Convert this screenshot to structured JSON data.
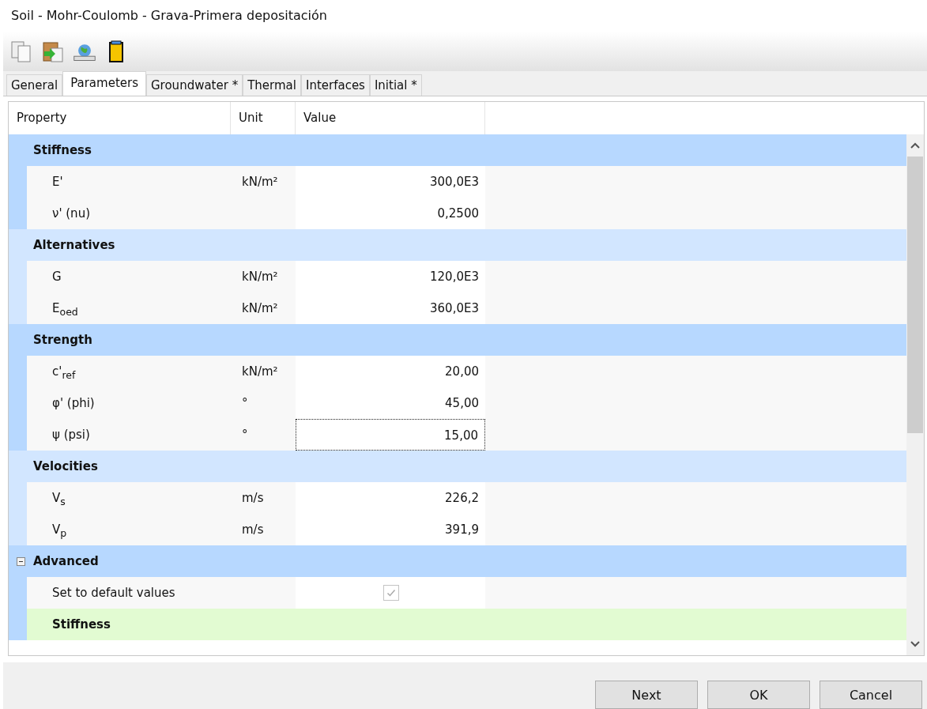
{
  "window": {
    "title": "Soil - Mohr-Coulomb - Grava-Primera depositación"
  },
  "toolbar": [
    {
      "kind": "copy"
    },
    {
      "kind": "paste"
    },
    {
      "kind": "globe"
    },
    {
      "kind": "column"
    }
  ],
  "tabs": [
    {
      "label": "General",
      "selected": false
    },
    {
      "label": "Parameters",
      "selected": true
    },
    {
      "label": "Groundwater *",
      "selected": false
    },
    {
      "label": "Thermal",
      "selected": false
    },
    {
      "label": "Interfaces",
      "selected": false
    },
    {
      "label": "Initial *",
      "selected": false
    }
  ],
  "table": {
    "columns": [
      "Property",
      "Unit",
      "Value"
    ],
    "groups": [
      {
        "title": "Stiffness",
        "color": "#b7d8ff",
        "rows": [
          {
            "kind": "param",
            "name": "E'",
            "unit": "kN/m²",
            "value": "300,0E3",
            "focused": false
          },
          {
            "kind": "param",
            "name": "ν' (nu)",
            "value": "0,2500",
            "focused": false
          }
        ]
      },
      {
        "title": "Alternatives",
        "color": "#d2e6ff",
        "rows": [
          {
            "kind": "param",
            "name": "G",
            "unit": "kN/m²",
            "value": "120,0E3",
            "focused": false
          },
          {
            "kind": "param",
            "name": "E$_{oed}$",
            "unit": "kN/m²",
            "value": "360,0E3",
            "focused": false
          }
        ]
      },
      {
        "title": "Strength",
        "color": "#b7d8ff",
        "rows": [
          {
            "kind": "param",
            "name": "c'$_{ref}$",
            "unit": "kN/m²",
            "value": "20,00",
            "focused": false
          },
          {
            "kind": "param",
            "name": "φ' (phi)",
            "unit": "°",
            "value": "45,00",
            "focused": false
          },
          {
            "kind": "param",
            "name": "ψ (psi)",
            "unit": "°",
            "value": "15,00",
            "focused": true
          }
        ]
      },
      {
        "title": "Velocities",
        "color": "#d2e6ff",
        "rows": [
          {
            "kind": "param",
            "name": "V$_{s}$",
            "unit": "m/s",
            "value": "226,2",
            "focused": false
          },
          {
            "kind": "param",
            "name": "V$_{p}$",
            "unit": "m/s",
            "value": "391,9",
            "focused": false
          }
        ]
      },
      {
        "title": "Advanced",
        "color": "#b7d8ff",
        "expanded": true,
        "rows": [
          {
            "kind": "checkbox",
            "name": "Set to default values",
            "checked": true,
            "disabled": true
          },
          {
            "kind": "subgroup",
            "name": "Stiffness",
            "color": "#e2fbd2"
          }
        ]
      }
    ]
  },
  "buttons": [
    "Next",
    "OK",
    "Cancel"
  ]
}
